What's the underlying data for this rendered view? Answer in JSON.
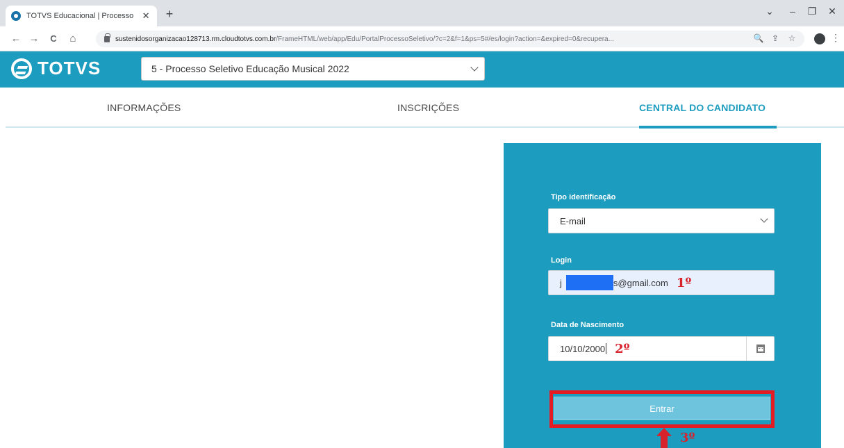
{
  "browser": {
    "tab_title": "TOTVS Educacional | Processo Se",
    "tab_close": "✕",
    "new_tab": "+",
    "window_controls": {
      "chevron": "⌄",
      "minimize": "–",
      "restore": "❐",
      "close": "✕"
    },
    "nav": {
      "back": "←",
      "forward": "→",
      "reload": "C",
      "home": "⌂"
    },
    "url_host": "sustenidosorganizacao128713.rm.cloudtotvs.com.br",
    "url_path": "/FrameHTML/web/app/Edu/PortalProcessoSeletivo/?c=2&f=1&ps=5#/es/login?action=&expired=0&recupera...",
    "omnibox_icons": {
      "zoom": "🔍",
      "share": "⇪",
      "bookmark": "☆"
    },
    "menu": "⋮"
  },
  "header": {
    "logo_text": "TOTVS",
    "process_select_value": "5 - Processo Seletivo Educação Musical 2022"
  },
  "nav_tabs": [
    {
      "label": "INFORMAÇÕES",
      "active": false
    },
    {
      "label": "INSCRIÇÕES",
      "active": false
    },
    {
      "label": "CENTRAL DO CANDIDATO",
      "active": true
    }
  ],
  "login": {
    "tipo_label": "Tipo identificação",
    "tipo_value": "E-mail",
    "login_label": "Login",
    "login_prefix": "j",
    "login_suffix": "s@gmail.com",
    "login_marker": "1º",
    "date_label": "Data de Nascimento",
    "date_value": "10/10/2000",
    "date_marker": "2º",
    "submit_label": "Entrar",
    "submit_marker": "3º"
  },
  "colors": {
    "brand": "#1c9cbe",
    "annotation": "#e51c23",
    "redaction": "#1e6ff3"
  }
}
